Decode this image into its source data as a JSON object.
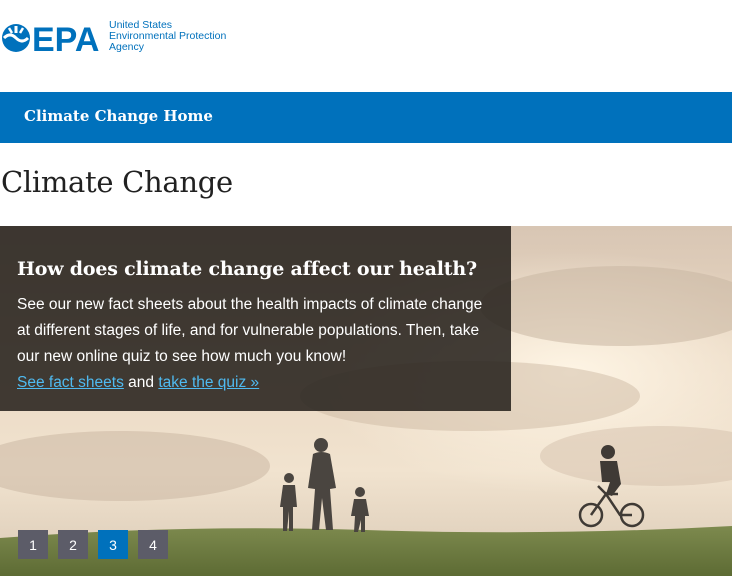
{
  "header": {
    "logo_text": "EPA",
    "agency_lines": [
      "United States",
      "Environmental Protection",
      "Agency"
    ]
  },
  "nav": {
    "home_label": "Climate Change Home"
  },
  "page": {
    "title": "Climate Change"
  },
  "hero": {
    "title": "How does climate change affect our health?",
    "body": "See our new fact sheets about the health impacts of climate change at different stages of life, and for vulnerable populations. Then, take our new online quiz to see how much you know!",
    "link1": "See fact sheets",
    "connector": "and",
    "link2": "take the quiz »"
  },
  "pager": {
    "pages": [
      "1",
      "2",
      "3",
      "4"
    ],
    "active_index": 2
  },
  "colors": {
    "brand_blue": "#0071bc",
    "pager_inactive": "#5c5c68",
    "link_color": "#4fbaf0"
  }
}
